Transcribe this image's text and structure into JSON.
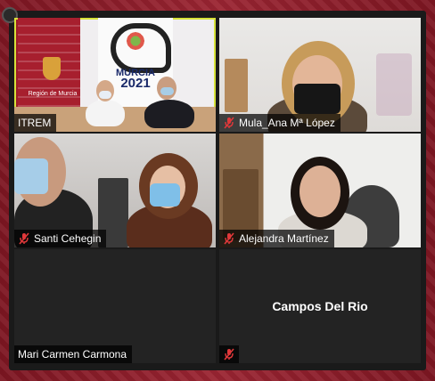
{
  "participants": [
    {
      "name": "ITREM",
      "muted": false,
      "active_speaker": true
    },
    {
      "name": "Mula_Ana Mª López",
      "muted": true,
      "active_speaker": false
    },
    {
      "name": "Santi Cehegin",
      "muted": true,
      "active_speaker": false
    },
    {
      "name": "Alejandra Martínez",
      "muted": true,
      "active_speaker": false
    },
    {
      "name": "Mari Carmen Carmona",
      "muted": false,
      "active_speaker": false
    },
    {
      "name": "Campos Del Rio",
      "muted": true,
      "active_speaker": false,
      "video": false
    }
  ],
  "video_text": {
    "banner_city": "MURCIA",
    "banner_year": "2021",
    "banner_region": "Región de Murcia"
  },
  "colors": {
    "active_border": "#d7e23a",
    "muted_icon": "#e0383a",
    "window_bg": "#1a1a1a"
  },
  "icons": {
    "muted": "mic-muted-icon"
  }
}
